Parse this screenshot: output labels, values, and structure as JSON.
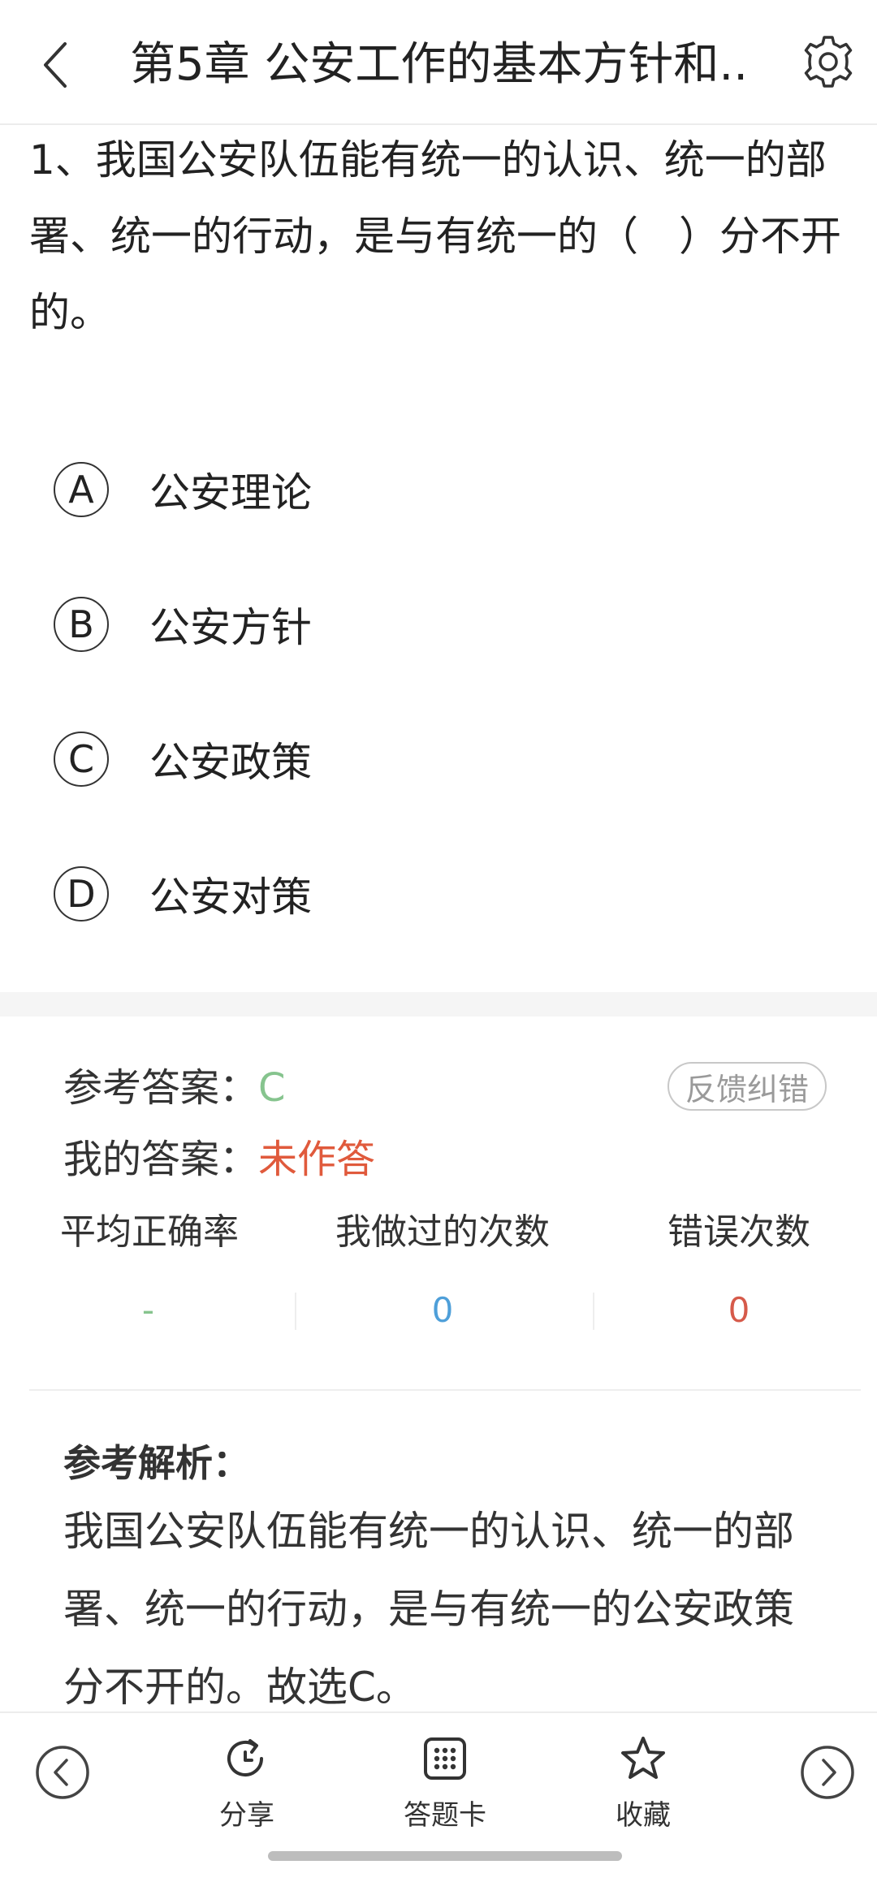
{
  "header": {
    "title": "第5章 公安工作的基本方针和..",
    "back_icon": "chevron-left-icon",
    "settings_icon": "gear-icon"
  },
  "question": {
    "text": "1、我国公安队伍能有统一的认识、统一的部署、统一的行动，是与有统一的（　）分不开的。",
    "options": [
      {
        "letter": "A",
        "text": "公安理论"
      },
      {
        "letter": "B",
        "text": "公安方针"
      },
      {
        "letter": "C",
        "text": "公安政策"
      },
      {
        "letter": "D",
        "text": "公安对策"
      }
    ]
  },
  "answer": {
    "ref_label": "参考答案：",
    "ref_value": "C",
    "my_label": "我的答案：",
    "my_value": "未作答",
    "feedback_label": "反馈纠错"
  },
  "stats": [
    {
      "label": "平均正确率",
      "value": "-"
    },
    {
      "label": "我做过的次数",
      "value": "0"
    },
    {
      "label": "错误次数",
      "value": "0"
    }
  ],
  "analysis": {
    "title": "参考解析：",
    "text": "我国公安队伍能有统一的认识、统一的部署、统一的行动，是与有统一的公安政策分不开的。故选C。"
  },
  "bottom_bar": {
    "share_label": "分享",
    "card_label": "答题卡",
    "favorite_label": "收藏"
  },
  "colors": {
    "ref_answer": "#86c48e",
    "my_answer": "#e05a3c",
    "times_done": "#4e9fd9",
    "error_count": "#d65a4a"
  }
}
